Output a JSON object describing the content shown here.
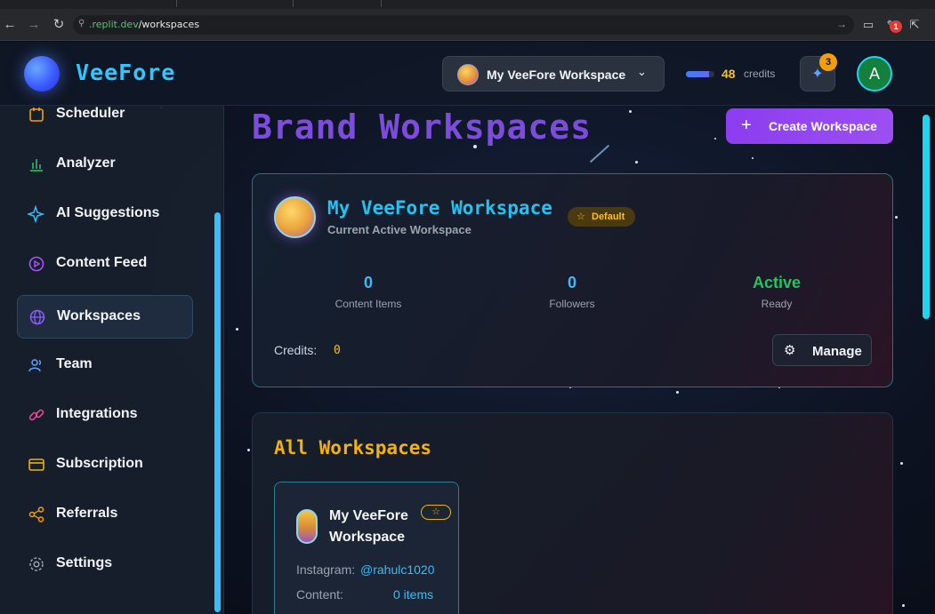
{
  "browser": {
    "url_prefix": ".replit.dev",
    "url_path": "/workspaces",
    "notification_count": "1"
  },
  "header": {
    "logo": "VeeFore",
    "workspace_switcher": "My VeeFore Workspace",
    "credits_value": "48",
    "credits_label": "credits",
    "notifications_badge": "3",
    "avatar_initial": "A"
  },
  "sidebar": {
    "items": [
      {
        "label": "Scheduler",
        "icon": "calendar-icon",
        "color": "#f59e0b"
      },
      {
        "label": "Analyzer",
        "icon": "bar-chart-icon",
        "color": "#22c55e"
      },
      {
        "label": "AI Suggestions",
        "icon": "sparkles-icon",
        "color": "#38bdf8"
      },
      {
        "label": "Content Feed",
        "icon": "play-circle-icon",
        "color": "#a855f7"
      },
      {
        "label": "Workspaces",
        "icon": "globe-icon",
        "color": "#8b5cf6"
      },
      {
        "label": "Team",
        "icon": "users-icon",
        "color": "#60a5fa"
      },
      {
        "label": "Integrations",
        "icon": "link-icon",
        "color": "#ec4899"
      },
      {
        "label": "Subscription",
        "icon": "credit-card-icon",
        "color": "#eab308"
      },
      {
        "label": "Referrals",
        "icon": "share-icon",
        "color": "#f59e0b"
      },
      {
        "label": "Settings",
        "icon": "gear-icon",
        "color": "#9ca3af"
      }
    ]
  },
  "main": {
    "title": "Brand Workspaces",
    "create_button": "Create Workspace",
    "current": {
      "name": "My VeeFore Workspace",
      "subtitle": "Current Active Workspace",
      "badge": "Default",
      "stats": [
        {
          "value": "0",
          "label": "Content Items"
        },
        {
          "value": "0",
          "label": "Followers"
        },
        {
          "value": "Active",
          "label": "Ready"
        }
      ],
      "credits_label": "Credits:",
      "credits_value": "0",
      "manage_button": "Manage"
    },
    "all": {
      "title": "All Workspaces",
      "tile": {
        "name": "My VeeFore Workspace",
        "instagram_label": "Instagram:",
        "instagram_value": "@rahulc1020",
        "content_label": "Content:",
        "content_value": "0 items"
      }
    }
  },
  "colors": {
    "accent_purple": "#8b3df0",
    "accent_cyan": "#22c3f2",
    "accent_gold": "#f5b20b",
    "active_green": "#22c55e"
  }
}
